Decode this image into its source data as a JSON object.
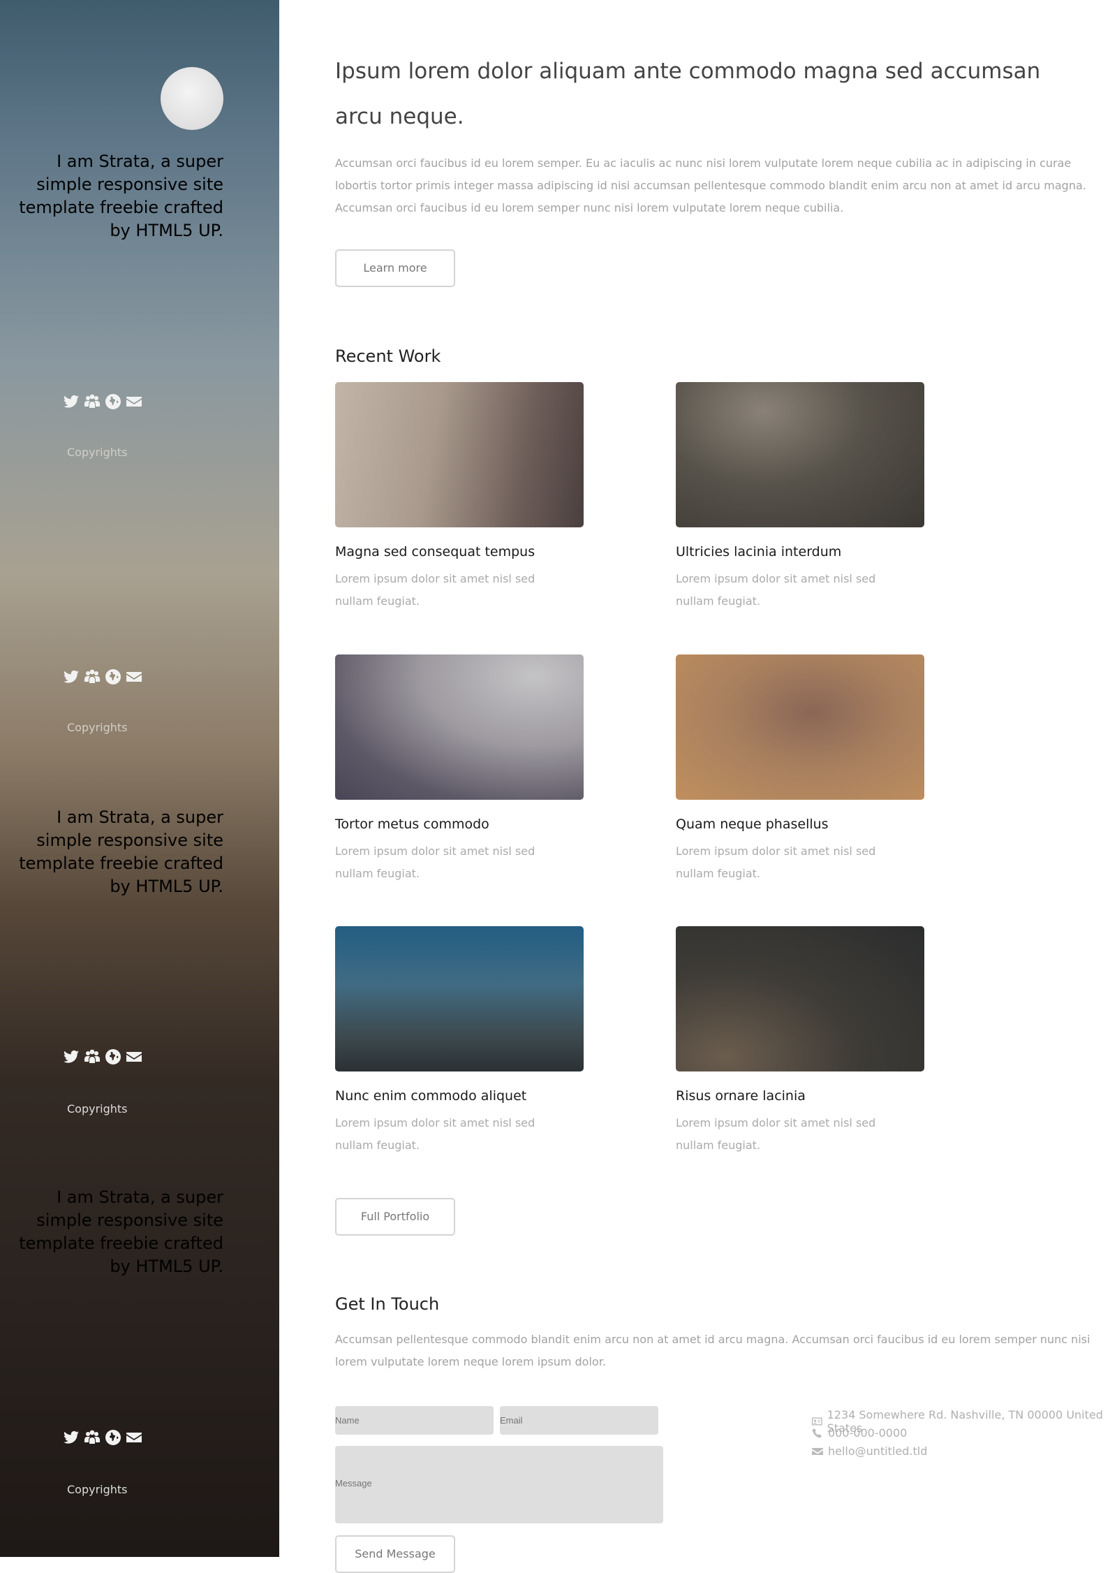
{
  "sidebar": {
    "tagline": "I am Strata, a super simple responsive site template freebie crafted by HTML5 UP.",
    "social": [
      "twitter-icon",
      "group-icon",
      "globe-icon",
      "envelope-icon"
    ],
    "copyright": "Copyrights"
  },
  "main": {
    "headline": "Ipsum lorem dolor aliquam ante commodo magna sed accumsan arcu neque.",
    "intro": "Accumsan orci faucibus id eu lorem semper. Eu ac iaculis ac nunc nisi lorem vulputate lorem neque cubilia ac in adipiscing in curae lobortis tortor primis integer massa adipiscing id nisi accumsan pellentesque commodo blandit enim arcu non at amet id arcu magna. Accumsan orci faucibus id eu lorem semper nunc nisi lorem vulputate lorem neque cubilia.",
    "learn_more": "Learn more"
  },
  "recent_work": {
    "heading": "Recent Work",
    "items": [
      {
        "title": "Magna sed consequat tempus",
        "desc": "Lorem ipsum dolor sit amet nisl sed nullam feugiat."
      },
      {
        "title": "Ultricies lacinia interdum",
        "desc": "Lorem ipsum dolor sit amet nisl sed nullam feugiat."
      },
      {
        "title": "Tortor metus commodo",
        "desc": "Lorem ipsum dolor sit amet nisl sed nullam feugiat."
      },
      {
        "title": "Quam neque phasellus",
        "desc": "Lorem ipsum dolor sit amet nisl sed nullam feugiat."
      },
      {
        "title": "Nunc enim commodo aliquet",
        "desc": "Lorem ipsum dolor sit amet nisl sed nullam feugiat."
      },
      {
        "title": "Risus ornare lacinia",
        "desc": "Lorem ipsum dolor sit amet nisl sed nullam feugiat."
      }
    ],
    "full_portfolio": "Full Portfolio"
  },
  "contact": {
    "heading": "Get In Touch",
    "desc": "Accumsan pellentesque commodo blandit enim arcu non at amet id arcu magna. Accumsan orci faucibus id eu lorem semper nunc nisi lorem vulputate lorem neque lorem ipsum dolor.",
    "name_placeholder": "Name",
    "email_placeholder": "Email",
    "message_placeholder": "Message",
    "send": "Send Message",
    "address": "1234 Somewhere Rd. Nashville, TN 00000 United States",
    "phone": "000-000-0000",
    "email": "hello@untitled.tld"
  }
}
